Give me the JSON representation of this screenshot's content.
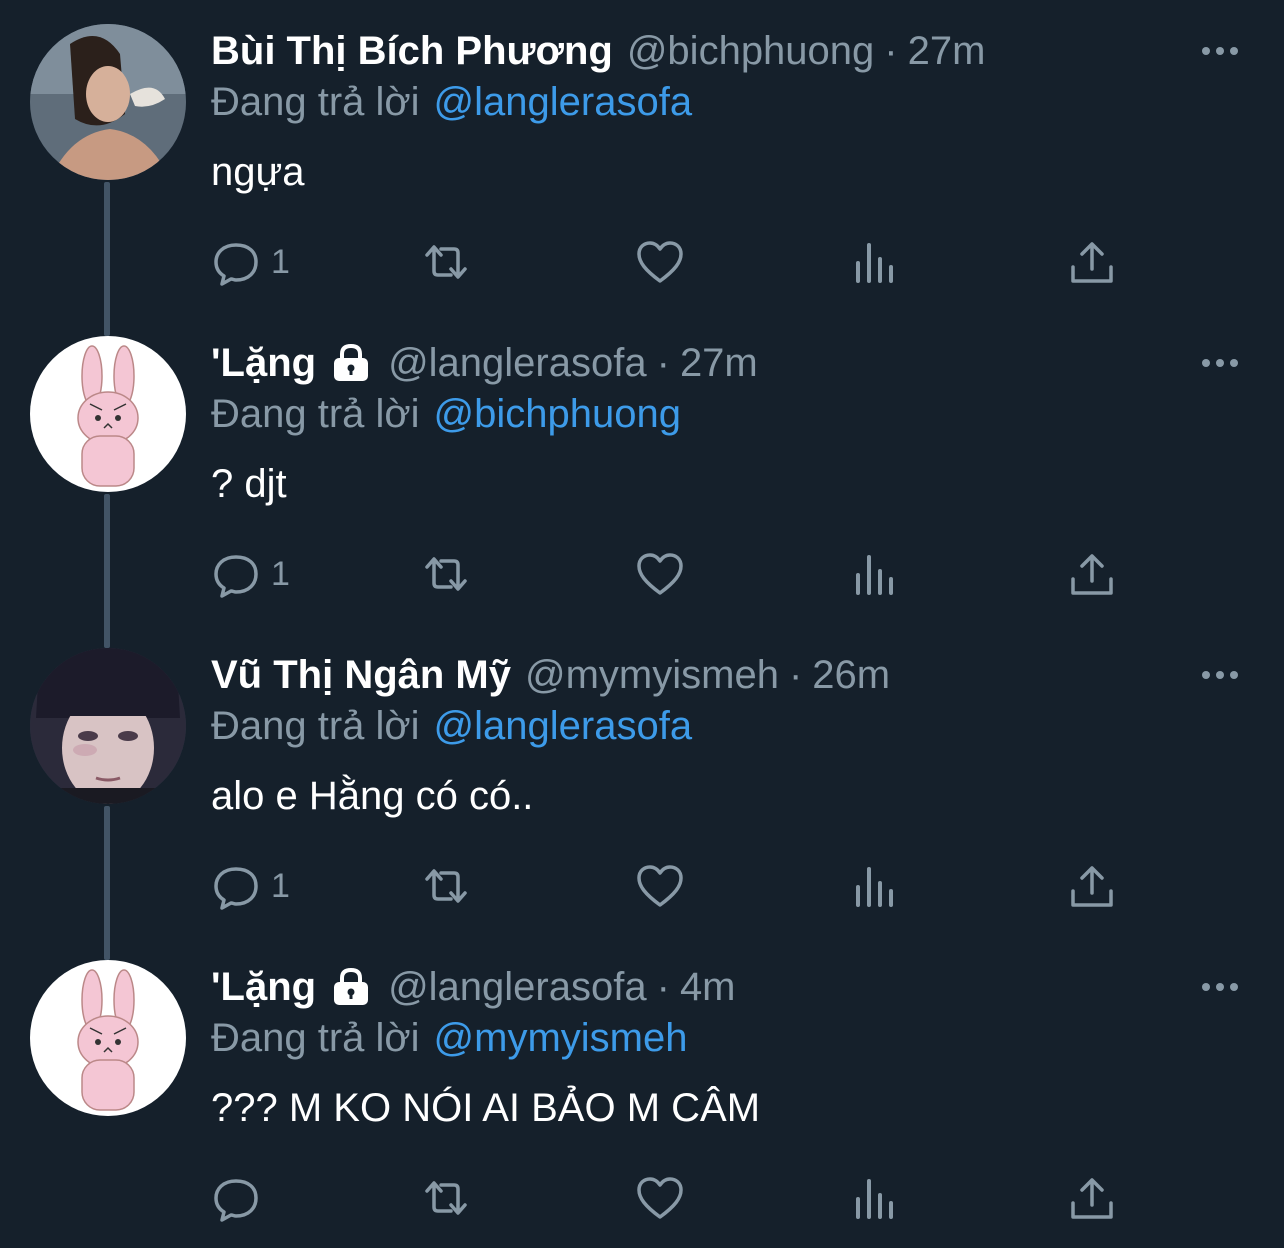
{
  "colors": {
    "background": "#15202b",
    "muted": "#8899a6",
    "link": "#3d9be9",
    "text": "#ffffff"
  },
  "icons": {
    "reply": "speech-bubble-icon",
    "retweet": "retweet-arrows-icon",
    "like": "heart-icon",
    "stats": "bar-chart-icon",
    "share": "upload-share-icon",
    "more": "ellipsis-icon",
    "lock": "padlock-icon"
  },
  "tweets": [
    {
      "name": "Bùi Thị Bích Phương",
      "handle": "@bichphuong",
      "sep": "·",
      "time": "27m",
      "protected": false,
      "reply_prefix": "Đang trả lời",
      "reply_to": "@langlerasofa",
      "text": "ngựa",
      "reply_count": "1"
    },
    {
      "name": "'Lặng",
      "handle": "@langlerasofa",
      "sep": "·",
      "time": "27m",
      "protected": true,
      "reply_prefix": "Đang trả lời",
      "reply_to": "@bichphuong",
      "text": "? djt",
      "reply_count": "1"
    },
    {
      "name": "Vũ Thị Ngân Mỹ",
      "handle": "@mymyismeh",
      "sep": "·",
      "time": "26m",
      "protected": false,
      "reply_prefix": "Đang trả lời",
      "reply_to": "@langlerasofa",
      "text": "alo e Hằng có có..",
      "reply_count": "1"
    },
    {
      "name": "'Lặng",
      "handle": "@langlerasofa",
      "sep": "·",
      "time": "4m",
      "protected": true,
      "reply_prefix": "Đang trả lời",
      "reply_to": "@mymyismeh",
      "text": "??? M KO NÓI AI BẢO M CÂM",
      "reply_count": ""
    }
  ]
}
